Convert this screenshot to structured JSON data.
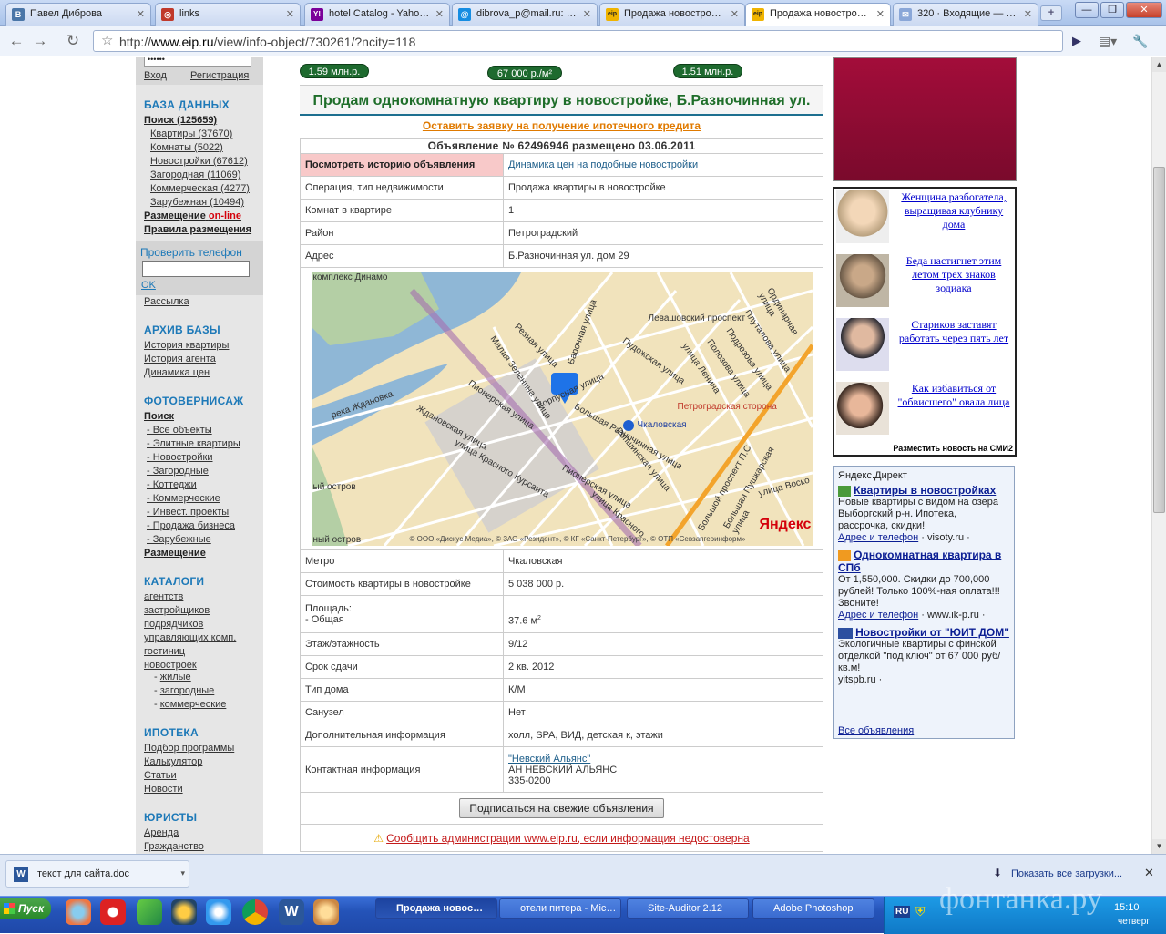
{
  "browser": {
    "tabs": [
      {
        "label": "Павел Диброва",
        "favicon": "vk-icon",
        "color": "#4a76a8",
        "glyph": "В"
      },
      {
        "label": "links",
        "favicon": "links-icon",
        "color": "#c0392b",
        "glyph": "◎"
      },
      {
        "label": "hotel Catalog - Yaho…",
        "favicon": "yahoo-icon",
        "color": "#7b0099",
        "glyph": "Y!"
      },
      {
        "label": "dibrova_p@mail.ru: …",
        "favicon": "mailru-icon",
        "color": "#168de2",
        "glyph": "@"
      },
      {
        "label": "Продажа новостро…",
        "favicon": "eip-icon",
        "color": "#f0b400",
        "glyph": "eip"
      },
      {
        "label": "Продажа новостро…",
        "favicon": "eip-icon",
        "color": "#f0b400",
        "glyph": "eip"
      },
      {
        "label": "320 · Входящие — …",
        "favicon": "mail-icon",
        "color": "#8aa7d8",
        "glyph": "✉"
      }
    ],
    "url_prefix": "http://",
    "url_host": "www.eip.ru",
    "url_path": "/view/info-object/730261/?ncity=118"
  },
  "sidebar": {
    "login": "Вход",
    "register": "Регистрация",
    "db_title": "БАЗА ДАННЫХ",
    "search_label": "Поиск (125659)",
    "db_items": [
      "Квартиры (37670)",
      "Комнаты (5022)",
      "Новостройки (67612)",
      "Загородная (11069)",
      "Коммерческая (4277)",
      "Зарубежная (10494)"
    ],
    "placement_prefix": "Размещение",
    "placement_online": "on-line",
    "rules": "Правила размещения",
    "check_phone": "Проверить телефон",
    "ok": "OK",
    "mailing": "Рассылка",
    "archive_title": "АРХИВ БАЗЫ",
    "archive_items": [
      "История квартиры",
      "История агента",
      "Динамика цен"
    ],
    "photo_title": "ФОТОВЕРНИСАЖ",
    "photo_search": "Поиск",
    "photo_items": [
      "- Все объекты",
      "- Элитные квартиры",
      "- Новостройки",
      "- Загородные",
      "- Коттеджи",
      "- Коммерческие",
      "- Инвест. проекты",
      "- Продажа бизнеса",
      "- Зарубежные"
    ],
    "photo_placement": "Размещение",
    "catalog_title": "КАТАЛОГИ",
    "catalog_items": [
      "агентств",
      "застройщиков",
      "подрядчиков",
      "управляющих комп.",
      "гостиниц",
      "новостроек"
    ],
    "catalog_sub": [
      "жилые",
      "загородные",
      "коммерческие"
    ],
    "mortgage_title": "ИПОТЕКА",
    "mortgage_items": [
      "Подбор программы",
      "Калькулятор",
      "Статьи",
      "Новости"
    ],
    "lawyers_title": "ЮРИСТЫ",
    "lawyers_items": [
      "Аренда",
      "Гражданство"
    ]
  },
  "listing": {
    "prices": [
      "1.59 млн.р.",
      "67 000 р./м²",
      "1.51 млн.р."
    ],
    "title": "Продам однокомнатную квартиру в новостройке, Б.Разночинная ул.",
    "mortgage_link": "Оставить заявку на получение ипотечного кредита",
    "ad_header": "Объявление № 62496946 размещено 03.06.2011",
    "history_link": "Посмотреть историю объявления",
    "dynamics_link": "Динамика цен на подобные новостройки",
    "rows_top": [
      {
        "k": "Операция, тип недвижимости",
        "v": "Продажа квартиры в новостройке"
      },
      {
        "k": "Комнат в квартире",
        "v": "1"
      },
      {
        "k": "Район",
        "v": "Петроградский"
      },
      {
        "k": "Адрес",
        "v": "Б.Разночинная ул. дом 29"
      }
    ],
    "metro_k": "Метро",
    "metro_v": "Чкаловская",
    "price_k": "Стоимость квартиры в новостройке",
    "price_v": "5 038 000 р.",
    "area_k1": "Площадь:",
    "area_k2": "- Общая",
    "area_v": "37.6 м",
    "rows_bottom": [
      {
        "k": "Этаж/этажность",
        "v": "9/12"
      },
      {
        "k": "Срок сдачи",
        "v": "2 кв. 2012"
      },
      {
        "k": "Тип дома",
        "v": "К/М"
      },
      {
        "k": "Санузел",
        "v": "Нет"
      },
      {
        "k": "Дополнительная информация",
        "v": "холл, SPA, ВИД, детская к, этажи"
      }
    ],
    "contact_k": "Контактная информация",
    "contact_link": "\"Невский Альянс\"",
    "contact_name": "АН НЕВСКИЙ АЛЬЯНС",
    "contact_phone": "335-0200",
    "subscribe": "Подписаться на свежие объявления",
    "report": "Сообщить администрации www.eip.ru, если информация недостоверна"
  },
  "map": {
    "labels": [
      "комплекс Динамо",
      "Левашовский проспект",
      "Плуталова улица",
      "Ординарная улица",
      "Резная улица",
      "Барочная улица",
      "Пудожская улица",
      "Подрезова улица",
      "Полозова улица",
      "улица Ленина",
      "Малая Зеленина улица",
      "Корпусная улица",
      "Петроградская сторона",
      "Чкаловская",
      "река Ждановка",
      "Пионерская улица",
      "Ждановская улица",
      "улица Красного Курсанта",
      "Большая Разночинная улица",
      "Ропшинская улица",
      "Большой проспект П.С.",
      "Большая Пушкарская улица",
      "улица Воско",
      "Пионерская улица",
      "улица Красного",
      "ый остров",
      "ный остров",
      "Яндекс"
    ],
    "copyright": "© ООО «Дискус Медиа», © ЗАО «Резидент», © КГ «Санкт-Петербург», © ОТП «Севзапгеоинформ»"
  },
  "news": [
    {
      "text": "Женщина разбогатела, выращивая клубнику дома"
    },
    {
      "text": "Беда настигнет этим летом трех знаков зодиака"
    },
    {
      "text": "Стариков заставят работать через пять лет"
    },
    {
      "text": "Как избавиться от \"обвисшего\" овала лица"
    }
  ],
  "news_footer": "Разместить новость на СМИ2",
  "direct": {
    "title": "Яндекс.Директ",
    "ads": [
      {
        "title": "Квартиры в новостройках",
        "body": "Новые квартиры с видом на озера Выборгский р-н. Ипотека, рассрочка, скидки!",
        "link1": "Адрес и телефон",
        "link2": "visoty.ru"
      },
      {
        "title": "Однокомнатная квартира в СПб",
        "body": "От 1,550,000. Скидки до 700,000 рублей! Только 100%-ная оплата!!! Звоните!",
        "link1": "Адрес и телефон",
        "link2": "www.ik-p.ru"
      },
      {
        "title": "Новостройки от \"ЮИТ ДОМ\"",
        "body": "Экологичные квартиры с финской отделкой \"под ключ\" от 67 000 руб/кв.м!",
        "link1": "",
        "link2": "yitspb.ru"
      }
    ],
    "all": "Все объявления"
  },
  "downloads": {
    "file": "текст для сайта.doc",
    "show_all": "Показать все загрузки..."
  },
  "taskbar": {
    "start": "Пуск",
    "items": [
      "Продажа новос…",
      "отели питера - Mic…",
      "Site-Auditor 2.12",
      "Adobe Photoshop"
    ],
    "lang": "RU",
    "time": "15:10",
    "day": "четверг",
    "watermark": "фонтанка.ру"
  }
}
